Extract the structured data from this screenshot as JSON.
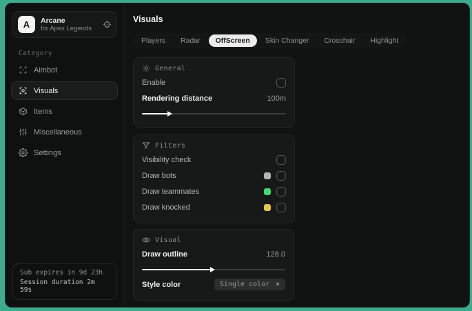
{
  "sidebar": {
    "brand": {
      "initial": "A",
      "name": "Arcane",
      "subtitle": "for Apex Legends"
    },
    "category_label": "Category",
    "items": [
      {
        "label": "Aimbot",
        "icon": "crosshair-frame-icon"
      },
      {
        "label": "Visuals",
        "icon": "scan-eye-icon"
      },
      {
        "label": "Items",
        "icon": "cube-icon"
      },
      {
        "label": "Miscellaneous",
        "icon": "sliders-icon"
      },
      {
        "label": "Settings",
        "icon": "gear-icon"
      }
    ],
    "footer": {
      "line1": "Sub expires in 9d 23h",
      "line2": "Session duration 2m 59s"
    }
  },
  "main": {
    "title": "Visuals",
    "tabs": [
      {
        "label": "Players"
      },
      {
        "label": "Radar"
      },
      {
        "label": "OffScreen",
        "active": true
      },
      {
        "label": "Skin Changer"
      },
      {
        "label": "Crosshair"
      },
      {
        "label": "Highlight"
      }
    ],
    "general": {
      "title": "General",
      "enable_label": "Enable",
      "enable_checked": false,
      "rendering_label": "Rendering distance",
      "rendering_value": "100m",
      "rendering_percent": 20
    },
    "visual": {
      "title": "Visual",
      "outline_label": "Draw outline",
      "outline_value": "128.0",
      "outline_percent": 50,
      "style_label": "Style color",
      "style_chip_value": "Single color",
      "style_chip_remove": "×"
    },
    "filters": {
      "title": "Filters",
      "rows": [
        {
          "label": "Visibility check",
          "checked": false
        },
        {
          "label": "Draw bots",
          "swatch": "#b3b5b4",
          "checked": false
        },
        {
          "label": "Draw teammates",
          "swatch": "#42d96f",
          "checked": false
        },
        {
          "label": "Draw knocked",
          "swatch": "#e4c44d",
          "checked": false
        }
      ]
    }
  },
  "colors": {
    "desktop_background": "#3dac8e",
    "window_background": "#111312",
    "card_background": "#171918",
    "active_tab_background": "#ececec",
    "swatch_bots": "#b3b5b4",
    "swatch_teammates": "#42d96f",
    "swatch_knocked": "#e4c44d"
  }
}
